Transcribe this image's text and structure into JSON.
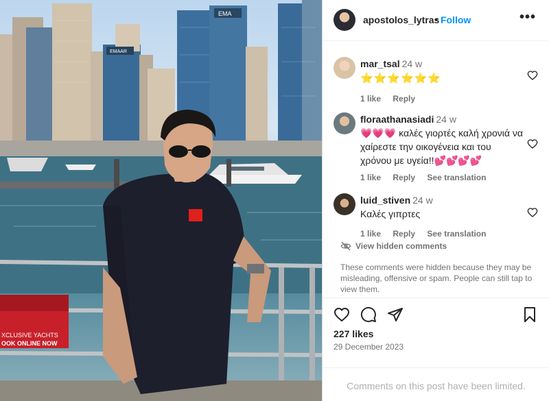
{
  "post": {
    "username": "apostolos_lytras",
    "separator": "•",
    "follow_label": "Follow",
    "more_icon": "more-horizontal-icon"
  },
  "comments": [
    {
      "username": "mar_tsal",
      "time": "24 w",
      "text": "⭐⭐⭐⭐⭐⭐",
      "likes": "1 like",
      "reply": "Reply",
      "translation": ""
    },
    {
      "username": "floraathanasiadi",
      "time": "24 w",
      "text": "💗💗💗 καλές γιορτές καλή χρονιά να χαίρεστε την οικογένεια και του χρόνου με υγεία!!💕💕💕💕",
      "likes": "1 like",
      "reply": "Reply",
      "translation": "See translation"
    },
    {
      "username": "luid_stiven",
      "time": "24 w",
      "text": "Καλές γιπρτες",
      "likes": "1 like",
      "reply": "Reply",
      "translation": "See translation"
    }
  ],
  "hidden": {
    "link": "View hidden comments",
    "note": "These comments were hidden because they may be misleading, offensive or spam. People can still tap to view them."
  },
  "actions": {
    "like_icon": "heart-icon",
    "comment_icon": "comment-icon",
    "share_icon": "share-icon",
    "save_icon": "bookmark-icon"
  },
  "likes": "227 likes",
  "date": "29 December 2023",
  "limited": "Comments on this post have been limited.",
  "photo": {
    "sign_text": "XCLUSIVE YACHTS",
    "sign_cta": "OOK ONLINE NOW",
    "building_sign": "EMA",
    "building_sign2": "EMAAR"
  },
  "colors": {
    "accent": "#0095f6",
    "text": "#262626",
    "secondary": "#737373"
  }
}
